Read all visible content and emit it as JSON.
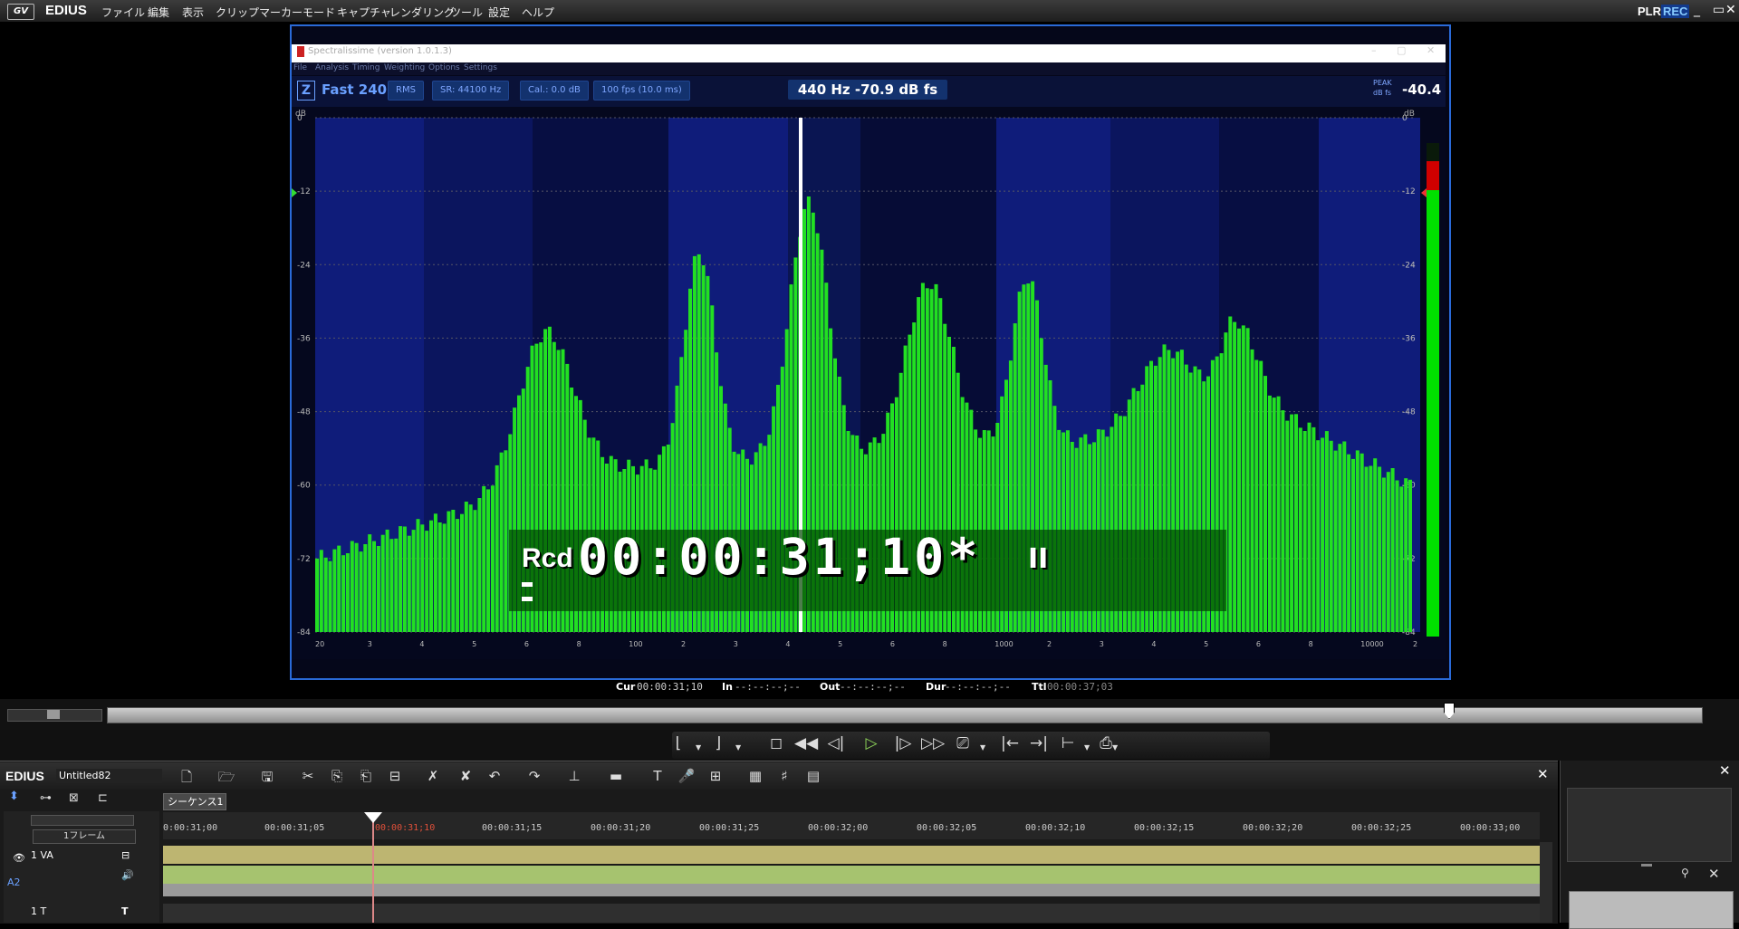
{
  "app": {
    "name": "EDIUS",
    "menu": [
      "ファイル",
      "編集",
      "表示",
      "クリップ",
      "マーカー",
      "モード",
      "キャプチャ",
      "レンダリング",
      "ツール",
      "設定",
      "ヘルプ"
    ],
    "plr": "PLR",
    "rec": "REC"
  },
  "spectrum": {
    "window_title": "Spectralissime (version 1.0.1.3)",
    "menu": [
      "File",
      "Analysis",
      "Timing",
      "Weighting",
      "Options",
      "Settings"
    ],
    "z_label": "Z",
    "mode": "Fast 240",
    "buttons": [
      "RMS",
      "SR: 44100 Hz",
      "Cal.: 0.0 dB",
      "100 fps (10.0 ms)"
    ],
    "readout": "440 Hz  -70.9 dB fs",
    "peak_label": "PEAK",
    "peak_unit": "dB fs",
    "peak_value": "-40.4",
    "db_unit": "dB",
    "db_ticks": [
      "0",
      "-12",
      "-24",
      "-36",
      "-48",
      "-60",
      "-72",
      "-84"
    ],
    "freq_labels": [
      "20",
      "3",
      "4",
      "5",
      "6",
      "8",
      "100",
      "2",
      "3",
      "4",
      "5",
      "6",
      "8",
      "1000",
      "2",
      "3",
      "4",
      "5",
      "6",
      "8",
      "10000",
      "2"
    ]
  },
  "timecode_overlay": {
    "rcd": "Rcd",
    "value": "00:00:31;10*",
    "pause": "II"
  },
  "info_bar": {
    "cur_label": "Cur",
    "cur": "00:00:31;10",
    "in_label": "In",
    "in": "--:--:--;--",
    "out_label": "Out",
    "out": "--:--:--;--",
    "dur_label": "Dur",
    "dur": "--:--:--;--",
    "ttl_label": "Ttl",
    "ttl": "00:00:37;03"
  },
  "scrub": {
    "position_fraction": 0.84
  },
  "timeline": {
    "logo": "EDIUS",
    "project": "Untitled82",
    "sequence_tab": "シーケンス1",
    "frame_select": "1フレーム",
    "ruler": [
      "0:00:31;00",
      "00:00:31;05",
      "00:00:31;10",
      "00:00:31;15",
      "00:00:31;20",
      "00:00:31;25",
      "00:00:32;00",
      "00:00:32;05",
      "00:00:32;10",
      "00:00:32;15",
      "00:00:32;20",
      "00:00:32;25",
      "00:00:33;00"
    ],
    "tracks": [
      {
        "name": "1 VA"
      },
      {
        "name": "1 T"
      }
    ],
    "audio_track_number": "A2"
  },
  "colors": {
    "accent": "#2a6ad8",
    "spectrum_bar": "#22e022",
    "playhead": "#e0503a"
  }
}
